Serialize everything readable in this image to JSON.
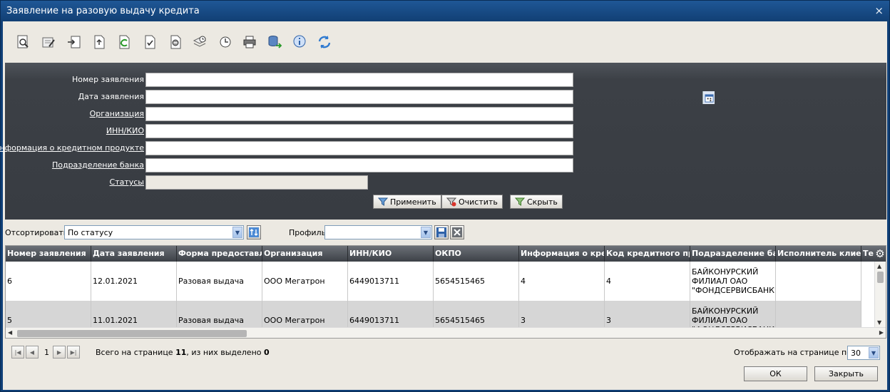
{
  "window": {
    "title": "Заявление на разовую выдачу кредита",
    "close_glyph": "×"
  },
  "toolbar": {
    "icons": [
      "view-icon",
      "edit-icon",
      "export-icon",
      "document-icon",
      "refresh-document-icon",
      "check-document-icon",
      "stop-document-icon",
      "schedule-icon",
      "history-icon",
      "print-icon",
      "database-icon",
      "info-icon",
      "reload-icon"
    ]
  },
  "filter": {
    "fields": [
      {
        "label": "Номер заявления",
        "value": ""
      },
      {
        "label": "Дата заявления",
        "value": ""
      },
      {
        "label": "Организация",
        "value": ""
      },
      {
        "label": "ИНН/КИО",
        "value": ""
      },
      {
        "label": "Информация о кредитном продукте",
        "value": ""
      },
      {
        "label": "Подразделение банка",
        "value": ""
      },
      {
        "label": "Статусы",
        "value": ""
      }
    ],
    "apply_label": "Применить",
    "clear_label": "Очистить",
    "hide_label": "Скрыть"
  },
  "sort": {
    "label": "Отсортировать",
    "value": "По статусу",
    "profile_label": "Профиль",
    "profile_value": ""
  },
  "table": {
    "columns": [
      "Номер заявления",
      "Дата заявления",
      "Форма предоставления",
      "Организация",
      "ИНН/КИО",
      "ОКПО",
      "Информация о кредитном продукте",
      "Код кредитного продукта",
      "Подразделение банка",
      "Исполнитель клиента",
      "Те"
    ],
    "rows": [
      [
        "6",
        "12.01.2021",
        "Разовая выдача",
        "ООО Мегатрон",
        "6449013711",
        "5654515465",
        "4",
        "4",
        "БАЙКОНУРСКИЙ ФИЛИАЛ ОАО \"ФОНДСЕРВИСБАНК\"",
        "",
        ""
      ],
      [
        "5",
        "11.01.2021",
        "Разовая выдача",
        "ООО Мегатрон",
        "6449013711",
        "5654515465",
        "3",
        "3",
        "БАЙКОНУРСКИЙ ФИЛИАЛ ОАО \"ФОНДСЕРВИСБАНК\"",
        "",
        ""
      ]
    ]
  },
  "pager": {
    "page": "1",
    "summary_prefix": "Всего на странице ",
    "total": "11",
    "summary_mid": ", из них выделено ",
    "selected": "0",
    "per_page_label": "Отображать на странице по",
    "per_page": "30"
  },
  "footer": {
    "ok_label": "ОК",
    "close_label": "Закрыть"
  }
}
